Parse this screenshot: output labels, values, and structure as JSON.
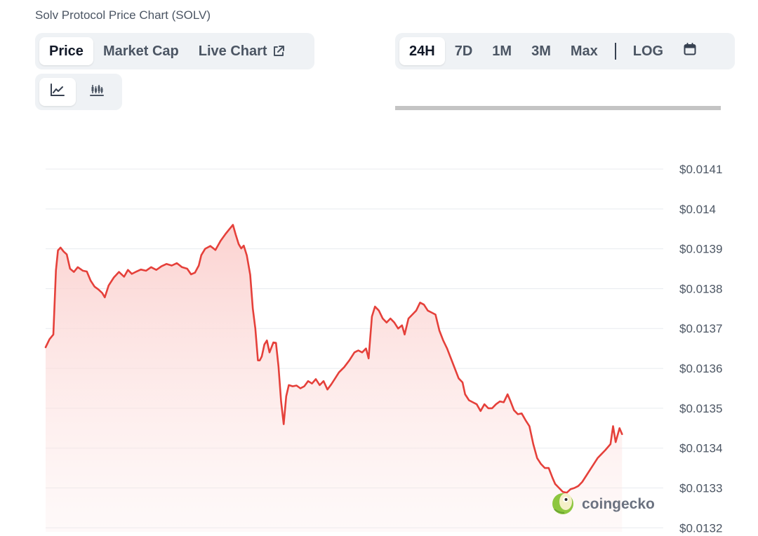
{
  "page": {
    "title": "Solv Protocol Price Chart (SOLV)"
  },
  "metric_tabs": [
    {
      "label": "Price",
      "active": true
    },
    {
      "label": "Market Cap",
      "active": false
    },
    {
      "label": "Live Chart",
      "active": false
    }
  ],
  "range_tabs": [
    {
      "label": "24H",
      "active": true
    },
    {
      "label": "7D",
      "active": false
    },
    {
      "label": "1M",
      "active": false
    },
    {
      "label": "3M",
      "active": false
    },
    {
      "label": "Max",
      "active": false
    },
    {
      "label": "LOG",
      "active": false
    }
  ],
  "icons": {
    "live_chart": "external-link-icon",
    "calendar": "calendar-icon",
    "line_chart": "line-chart-icon",
    "candlestick": "candlestick-icon"
  },
  "watermark": {
    "text": "coingecko"
  },
  "colors": {
    "line": "#e5403a",
    "fill": "#fde0df",
    "grid": "#e8ebef"
  },
  "chart_data": {
    "type": "area",
    "title": "",
    "xlabel": "",
    "ylabel": "",
    "ylim": [
      0.0132,
      0.01411
    ],
    "y_ticks": [
      {
        "label": "$0.0141",
        "value": 0.01411
      },
      {
        "label": "$0.014",
        "value": 0.01401
      },
      {
        "label": "$0.0139",
        "value": 0.01391
      },
      {
        "label": "$0.0138",
        "value": 0.01381
      },
      {
        "label": "$0.0137",
        "value": 0.01371
      },
      {
        "label": "$0.0136",
        "value": 0.01361
      },
      {
        "label": "$0.0135",
        "value": 0.01351
      },
      {
        "label": "$0.0134",
        "value": 0.01341
      },
      {
        "label": "$0.0133",
        "value": 0.01331
      },
      {
        "label": "$0.0132",
        "value": 0.01321
      }
    ],
    "grid": true,
    "x_range": [
      0,
      24
    ],
    "series": [
      {
        "values": [
          [
            0.0,
            0.013663
          ],
          [
            0.15,
            0.013683
          ],
          [
            0.3,
            0.013695
          ],
          [
            0.4,
            0.013856
          ],
          [
            0.48,
            0.013906
          ],
          [
            0.58,
            0.013913
          ],
          [
            0.7,
            0.013903
          ],
          [
            0.82,
            0.013896
          ],
          [
            0.95,
            0.01386
          ],
          [
            1.1,
            0.013852
          ],
          [
            1.25,
            0.013864
          ],
          [
            1.45,
            0.013855
          ],
          [
            1.6,
            0.013853
          ],
          [
            1.75,
            0.01383
          ],
          [
            1.9,
            0.013815
          ],
          [
            2.05,
            0.013808
          ],
          [
            2.2,
            0.013799
          ],
          [
            2.3,
            0.013788
          ],
          [
            2.45,
            0.013818
          ],
          [
            2.65,
            0.013838
          ],
          [
            2.85,
            0.013852
          ],
          [
            3.05,
            0.01384
          ],
          [
            3.2,
            0.013857
          ],
          [
            3.35,
            0.013847
          ],
          [
            3.5,
            0.013852
          ],
          [
            3.7,
            0.013858
          ],
          [
            3.9,
            0.013855
          ],
          [
            4.1,
            0.013864
          ],
          [
            4.3,
            0.013857
          ],
          [
            4.5,
            0.013866
          ],
          [
            4.7,
            0.013872
          ],
          [
            4.9,
            0.013868
          ],
          [
            5.1,
            0.013874
          ],
          [
            5.3,
            0.013864
          ],
          [
            5.5,
            0.01386
          ],
          [
            5.65,
            0.013846
          ],
          [
            5.8,
            0.01385
          ],
          [
            5.95,
            0.013868
          ],
          [
            6.05,
            0.013894
          ],
          [
            6.2,
            0.01391
          ],
          [
            6.4,
            0.013917
          ],
          [
            6.6,
            0.013907
          ],
          [
            6.8,
            0.01393
          ],
          [
            7.0,
            0.013948
          ],
          [
            7.15,
            0.01396
          ],
          [
            7.28,
            0.01397
          ],
          [
            7.38,
            0.013947
          ],
          [
            7.5,
            0.013922
          ],
          [
            7.6,
            0.013911
          ],
          [
            7.7,
            0.013918
          ],
          [
            7.82,
            0.013893
          ],
          [
            7.95,
            0.013845
          ],
          [
            8.05,
            0.01376
          ],
          [
            8.15,
            0.01371
          ],
          [
            8.25,
            0.01363
          ],
          [
            8.32,
            0.01363
          ],
          [
            8.4,
            0.01364
          ],
          [
            8.5,
            0.01367
          ],
          [
            8.6,
            0.01368
          ],
          [
            8.7,
            0.01365
          ],
          [
            8.85,
            0.013675
          ],
          [
            8.95,
            0.013674
          ],
          [
            9.05,
            0.013615
          ],
          [
            9.15,
            0.013527
          ],
          [
            9.25,
            0.01347
          ],
          [
            9.35,
            0.01354
          ],
          [
            9.45,
            0.013568
          ],
          [
            9.6,
            0.013565
          ],
          [
            9.75,
            0.013567
          ],
          [
            9.9,
            0.01356
          ],
          [
            10.05,
            0.013565
          ],
          [
            10.2,
            0.013578
          ],
          [
            10.35,
            0.013572
          ],
          [
            10.5,
            0.013583
          ],
          [
            10.65,
            0.013568
          ],
          [
            10.8,
            0.013578
          ],
          [
            10.95,
            0.013557
          ],
          [
            11.1,
            0.01357
          ],
          [
            11.25,
            0.013585
          ],
          [
            11.4,
            0.0136
          ],
          [
            11.6,
            0.013613
          ],
          [
            11.8,
            0.01363
          ],
          [
            12.0,
            0.01365
          ],
          [
            12.15,
            0.013655
          ],
          [
            12.3,
            0.01365
          ],
          [
            12.45,
            0.01366
          ],
          [
            12.55,
            0.013635
          ],
          [
            12.68,
            0.01374
          ],
          [
            12.8,
            0.013765
          ],
          [
            12.95,
            0.013755
          ],
          [
            13.1,
            0.013735
          ],
          [
            13.25,
            0.013725
          ],
          [
            13.4,
            0.013735
          ],
          [
            13.55,
            0.013725
          ],
          [
            13.7,
            0.01371
          ],
          [
            13.85,
            0.013718
          ],
          [
            13.95,
            0.013695
          ],
          [
            14.1,
            0.013735
          ],
          [
            14.25,
            0.013745
          ],
          [
            14.4,
            0.013755
          ],
          [
            14.55,
            0.013775
          ],
          [
            14.7,
            0.01377
          ],
          [
            14.85,
            0.013755
          ],
          [
            15.0,
            0.01375
          ],
          [
            15.15,
            0.013745
          ],
          [
            15.3,
            0.013705
          ],
          [
            15.45,
            0.01368
          ],
          [
            15.6,
            0.01366
          ],
          [
            15.75,
            0.013635
          ],
          [
            15.9,
            0.01361
          ],
          [
            16.05,
            0.013585
          ],
          [
            16.2,
            0.013575
          ],
          [
            16.3,
            0.013545
          ],
          [
            16.45,
            0.01353
          ],
          [
            16.6,
            0.013525
          ],
          [
            16.75,
            0.01352
          ],
          [
            16.9,
            0.013503
          ],
          [
            17.05,
            0.01352
          ],
          [
            17.2,
            0.01351
          ],
          [
            17.35,
            0.01351
          ],
          [
            17.5,
            0.01352
          ],
          [
            17.65,
            0.013527
          ],
          [
            17.8,
            0.013525
          ],
          [
            17.95,
            0.013545
          ],
          [
            18.05,
            0.01353
          ],
          [
            18.2,
            0.013505
          ],
          [
            18.35,
            0.013495
          ],
          [
            18.5,
            0.013497
          ],
          [
            18.65,
            0.01348
          ],
          [
            18.8,
            0.013465
          ],
          [
            18.95,
            0.01342
          ],
          [
            19.1,
            0.013385
          ],
          [
            19.25,
            0.01337
          ],
          [
            19.4,
            0.01336
          ],
          [
            19.55,
            0.01336
          ],
          [
            19.7,
            0.013335
          ],
          [
            19.8,
            0.01332
          ],
          [
            19.95,
            0.01331
          ],
          [
            20.1,
            0.0133
          ],
          [
            20.25,
            0.013298
          ],
          [
            20.4,
            0.013307
          ],
          [
            20.55,
            0.01331
          ],
          [
            20.7,
            0.013315
          ],
          [
            20.85,
            0.013325
          ],
          [
            21.0,
            0.01334
          ],
          [
            21.15,
            0.013355
          ],
          [
            21.3,
            0.01337
          ],
          [
            21.45,
            0.013385
          ],
          [
            21.6,
            0.013395
          ],
          [
            21.75,
            0.013405
          ],
          [
            21.95,
            0.01342
          ],
          [
            22.05,
            0.013465
          ],
          [
            22.15,
            0.013425
          ],
          [
            22.3,
            0.01346
          ],
          [
            22.4,
            0.013445
          ]
        ]
      }
    ]
  }
}
